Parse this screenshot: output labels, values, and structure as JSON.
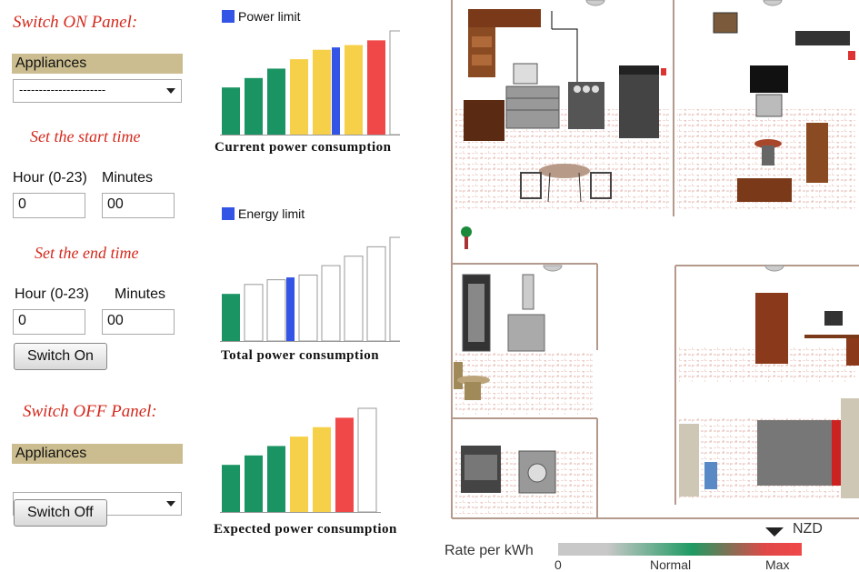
{
  "switch_on": {
    "title": "Switch ON Panel:",
    "appliances_label": "Appliances",
    "appliance_value": "----------------------",
    "start_title": "Set the start time",
    "start_hour_label": "Hour (0-23)",
    "start_minutes_label": "Minutes",
    "start_hour_value": "0",
    "start_minutes_value": "00",
    "end_title": "Set the end time",
    "end_hour_label": "Hour (0-23)",
    "end_minutes_label": "Minutes",
    "end_hour_value": "0",
    "end_minutes_value": "00",
    "button": "Switch On"
  },
  "switch_off": {
    "title": "Switch OFF Panel:",
    "appliances_label": "Appliances",
    "appliance_value": "----------------------",
    "button": "Switch Off"
  },
  "charts": {
    "current": {
      "legend": "Power  limit",
      "caption": "Current power consumption"
    },
    "total": {
      "legend": "Energy limit",
      "caption": "Total power consumption"
    },
    "expected": {
      "caption": "Expected power consumption"
    }
  },
  "rate": {
    "currency": "NZD",
    "label": "Rate per kWh",
    "tick_min": "0",
    "tick_mid": "Normal",
    "tick_max": "Max"
  },
  "colors": {
    "accent_red": "#d42a1e",
    "bar_green": "#1a9463",
    "bar_yellow": "#f7d04a",
    "bar_red": "#f04848",
    "limit_blue": "#3355e6"
  },
  "chart_data": [
    {
      "type": "bar",
      "caption": "Current power consumption",
      "values": [
        5,
        6,
        7,
        8,
        9,
        9.5,
        10,
        11
      ],
      "colors": [
        "green",
        "green",
        "green",
        "yellow",
        "yellow",
        "yellow",
        "red",
        "white"
      ],
      "limit_marker_after_index": 4,
      "ylim": [
        0,
        11
      ]
    },
    {
      "type": "bar",
      "caption": "Total power consumption",
      "values": [
        5,
        6,
        6.5,
        7,
        8,
        9,
        10,
        11
      ],
      "colors": [
        "green",
        "white",
        "white",
        "white",
        "white",
        "white",
        "white",
        "white"
      ],
      "limit_marker_after_index": 2,
      "ylim": [
        0,
        11
      ]
    },
    {
      "type": "bar",
      "caption": "Expected power consumption",
      "values": [
        5,
        6,
        7,
        8,
        9,
        10,
        11
      ],
      "colors": [
        "green",
        "green",
        "green",
        "yellow",
        "yellow",
        "red",
        "white"
      ],
      "ylim": [
        0,
        11
      ]
    }
  ]
}
